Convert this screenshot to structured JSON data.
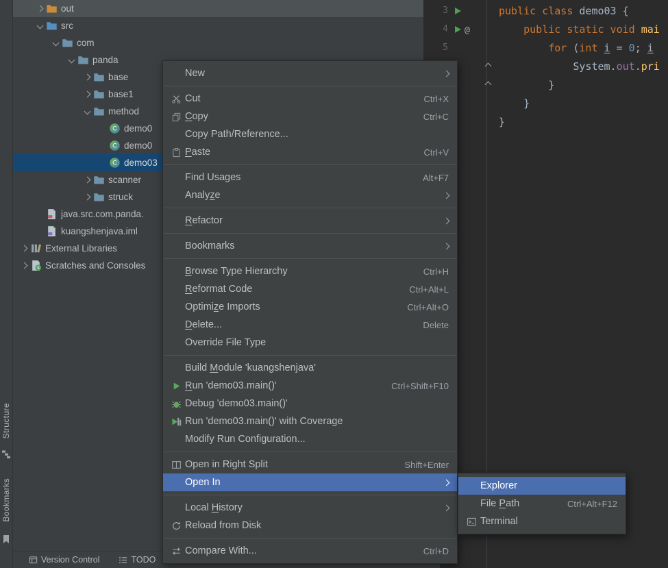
{
  "theme": {
    "panel_bg": "#3c3f41",
    "editor_bg": "#2b2b2b",
    "menu_bg": "#3f4243",
    "menu_selection": "#4b6eaf",
    "tree_selection": "#164672",
    "tree_hover_row": "#4d5254",
    "keyword_color": "#cc7832",
    "number_color": "#6897bb",
    "method_color": "#ffc66b",
    "field_color": "#9876aa",
    "code_text_color": "#a9b7c6",
    "run_green": "#4da24f"
  },
  "activity_bar": {
    "structure_label": "Structure",
    "bookmarks_label": "Bookmarks"
  },
  "project_tree": {
    "items": [
      {
        "label": "out",
        "level": 1,
        "arrow": "collapsed",
        "icon": "folder-out",
        "highlight": true
      },
      {
        "label": "src",
        "level": 1,
        "arrow": "expanded",
        "icon": "folder-src"
      },
      {
        "label": "com",
        "level": 2,
        "arrow": "expanded",
        "icon": "folder"
      },
      {
        "label": "panda",
        "level": 3,
        "arrow": "expanded",
        "icon": "folder"
      },
      {
        "label": "base",
        "level": 4,
        "arrow": "collapsed",
        "icon": "folder"
      },
      {
        "label": "base1",
        "level": 4,
        "arrow": "collapsed",
        "icon": "folder"
      },
      {
        "label": "method",
        "level": 4,
        "arrow": "expanded",
        "icon": "folder"
      },
      {
        "label": "demo0",
        "level": 5,
        "icon": "java-class"
      },
      {
        "label": "demo0",
        "level": 5,
        "icon": "java-class"
      },
      {
        "label": "demo03",
        "level": 5,
        "icon": "java-class",
        "selected": true
      },
      {
        "label": "scanner",
        "level": 4,
        "arrow": "collapsed",
        "icon": "folder"
      },
      {
        "label": "struck",
        "level": 4,
        "arrow": "collapsed",
        "icon": "folder"
      },
      {
        "label": "java.src.com.panda.",
        "level": 1,
        "icon": "java-file"
      },
      {
        "label": "kuangshenjava.iml",
        "level": 1,
        "icon": "iml-file"
      },
      {
        "label": "External Libraries",
        "level": 0,
        "arrow": "collapsed",
        "icon": "external-libraries"
      },
      {
        "label": "Scratches and Consoles",
        "level": 0,
        "arrow": "collapsed",
        "icon": "scratches"
      }
    ]
  },
  "context_menu": {
    "items": [
      {
        "label": "New",
        "submenu": true
      },
      {
        "type": "separator"
      },
      {
        "label": "Cut",
        "icon": "scissors",
        "shortcut": "Ctrl+X"
      },
      {
        "label": "Copy",
        "icon": "copy",
        "shortcut": "Ctrl+C",
        "m": "C"
      },
      {
        "label": "Copy Path/Reference..."
      },
      {
        "label": "Paste",
        "icon": "paste",
        "shortcut": "Ctrl+V",
        "m": "P"
      },
      {
        "type": "separator"
      },
      {
        "label": "Find Usages",
        "shortcut": "Alt+F7"
      },
      {
        "label": "Analyze",
        "submenu": true,
        "m": "z"
      },
      {
        "type": "separator"
      },
      {
        "label": "Refactor",
        "submenu": true,
        "m": "R"
      },
      {
        "type": "separator"
      },
      {
        "label": "Bookmarks",
        "submenu": true
      },
      {
        "type": "separator"
      },
      {
        "label": "Browse Type Hierarchy",
        "shortcut": "Ctrl+H",
        "m": "B"
      },
      {
        "label": "Reformat Code",
        "shortcut": "Ctrl+Alt+L",
        "m": "R"
      },
      {
        "label": "Optimize Imports",
        "shortcut": "Ctrl+Alt+O",
        "m": "z"
      },
      {
        "label": "Delete...",
        "shortcut": "Delete",
        "m": "D"
      },
      {
        "label": "Override File Type"
      },
      {
        "type": "separator"
      },
      {
        "label": "Build Module 'kuangshenjava'",
        "m": "M"
      },
      {
        "label": "Run 'demo03.main()'",
        "icon": "run",
        "shortcut": "Ctrl+Shift+F10",
        "m": "R"
      },
      {
        "label": "Debug 'demo03.main()'",
        "icon": "debug"
      },
      {
        "label": "Run 'demo03.main()' with Coverage",
        "icon": "coverage"
      },
      {
        "label": "Modify Run Configuration..."
      },
      {
        "type": "separator"
      },
      {
        "label": "Open in Right Split",
        "icon": "split",
        "shortcut": "Shift+Enter"
      },
      {
        "label": "Open In",
        "submenu": true,
        "selected": true
      },
      {
        "type": "separator"
      },
      {
        "label": "Local History",
        "submenu": true,
        "m": "H"
      },
      {
        "label": "Reload from Disk",
        "icon": "reload"
      },
      {
        "type": "separator"
      },
      {
        "label": "Compare With...",
        "icon": "compare",
        "shortcut": "Ctrl+D"
      }
    ]
  },
  "open_in_submenu": {
    "items": [
      {
        "label": "Explorer",
        "selected": true
      },
      {
        "label": "File Path",
        "shortcut": "Ctrl+Alt+F12",
        "m": "P"
      },
      {
        "label": "Terminal",
        "icon": "terminal"
      }
    ]
  },
  "editor": {
    "lines": [
      {
        "num": "3",
        "gutter": [
          "run"
        ],
        "segments": [
          [
            "kw",
            "public class "
          ],
          [
            "plain",
            "demo03 {"
          ]
        ]
      },
      {
        "num": "4",
        "gutter": [
          "run",
          "at-annotation"
        ],
        "segments": [
          [
            "plain",
            "    "
          ],
          [
            "kw",
            "public static void "
          ],
          [
            "fn",
            "mai"
          ]
        ]
      },
      {
        "num": "5",
        "segments": [
          [
            "plain",
            "        "
          ],
          [
            "kw",
            "for "
          ],
          [
            "plain",
            "("
          ],
          [
            "kw",
            "int "
          ],
          [
            "var",
            "i"
          ],
          [
            "plain",
            " = "
          ],
          [
            "lit",
            "0"
          ],
          [
            "plain",
            "; "
          ],
          [
            "var",
            "i"
          ]
        ]
      },
      {
        "num": "",
        "fold": "up",
        "segments": [
          [
            "plain",
            "            System."
          ],
          [
            "field",
            "out"
          ],
          [
            "plain",
            "."
          ],
          [
            "fn",
            "pri"
          ]
        ]
      },
      {
        "num": "",
        "fold": "up",
        "segments": [
          [
            "plain",
            "        }"
          ]
        ]
      },
      {
        "num": "",
        "segments": [
          [
            "plain",
            "    }"
          ]
        ]
      },
      {
        "num": "",
        "segments": [
          [
            "plain",
            "}"
          ]
        ]
      }
    ]
  },
  "status_bar": {
    "version_control_label": "Version Control",
    "todo_label": "TODO"
  }
}
